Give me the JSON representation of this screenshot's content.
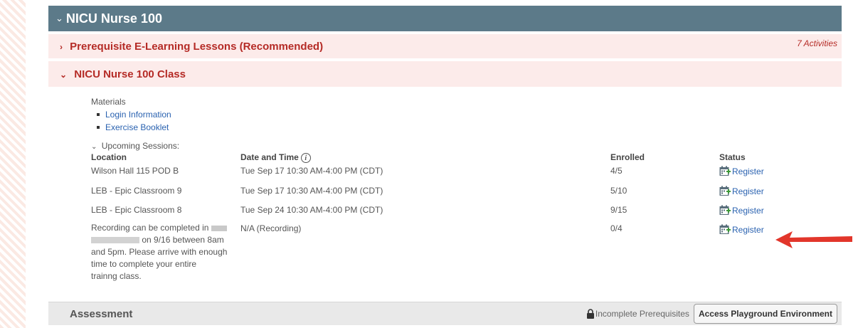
{
  "course": {
    "title": "NICU Nurse 100"
  },
  "groups": [
    {
      "title": "Prerequisite E-Learning Lessons (Recommended)",
      "activities": "7 Activities"
    },
    {
      "title": "NICU Nurse 100 Class"
    }
  ],
  "materials": {
    "label": "Materials",
    "items": [
      "Login Information",
      "Exercise Booklet"
    ]
  },
  "sessions": {
    "toggle_label": "Upcoming Sessions:",
    "headers": {
      "location": "Location",
      "datetime": "Date and Time",
      "enrolled": "Enrolled",
      "status": "Status"
    },
    "rows": [
      {
        "location": "Wilson Hall 115 POD B",
        "datetime": "Tue Sep 17 10:30 AM-4:00 PM (CDT)",
        "enrolled": "4/5",
        "status": "Register"
      },
      {
        "location": "LEB - Epic Classroom 9",
        "datetime": "Tue Sep 17 10:30 AM-4:00 PM (CDT)",
        "enrolled": "5/10",
        "status": "Register"
      },
      {
        "location": "LEB - Epic Classroom 8",
        "datetime": "Tue Sep 24 10:30 AM-4:00 PM (CDT)",
        "enrolled": "9/15",
        "status": "Register"
      },
      {
        "location_line1": "Recording can be completed in",
        "location_line2": "on 9/16 between 8am",
        "location_line3": "and 5pm. Please arrive with enough",
        "location_line4": "time to complete your entire",
        "location_line5": "trainng class.",
        "datetime": "N/A (Recording)",
        "enrolled": "0/4",
        "status": "Register"
      }
    ]
  },
  "assessment": {
    "title": "Assessment",
    "prereq_text": "Incomplete Prerequisites",
    "button_label": "Access Playground Environment"
  },
  "colors": {
    "header_bg": "#5c7a89",
    "group_bg": "#fcebea",
    "group_title": "#b52b26",
    "link": "#2a62b0",
    "annotation_arrow": "#e2362b"
  },
  "icons": [
    "chevron-down-icon",
    "chevron-right-icon",
    "info-icon",
    "calendar-add-icon",
    "lock-icon",
    "red-arrow-icon"
  ]
}
